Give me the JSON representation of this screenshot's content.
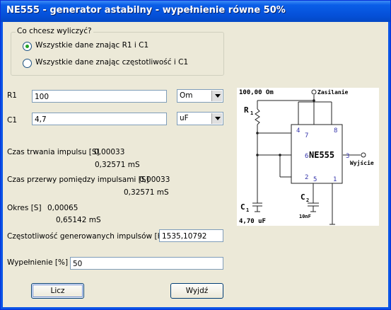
{
  "window": {
    "title": "NE555 - generator astabilny - wypełnienie równe 50%"
  },
  "mode": {
    "legend": "Co chcesz wyliczyć?",
    "options": [
      {
        "label": "Wszystkie dane znając R1 i C1",
        "selected": true
      },
      {
        "label": "Wszystkie dane znając częstotliwość i C1",
        "selected": false
      }
    ]
  },
  "inputs": {
    "r1": {
      "label": "R1",
      "value": "100",
      "unit": "Om"
    },
    "c1": {
      "label": "C1",
      "value": "4,7",
      "unit": "uF"
    }
  },
  "results": {
    "pulse": {
      "label": "Czas trwania impulsu [S]",
      "value": "0,00033",
      "value_ms": "0,32571 mS"
    },
    "gap": {
      "label": "Czas przerwy pomiędzy impulsami [S]",
      "value": "0,00033",
      "value_ms": "0,32571 mS"
    },
    "period": {
      "label": "Okres [S]",
      "value": "0,00065",
      "value_ms": "0,65142 mS"
    },
    "frequency": {
      "label": "Częstotliwość generowanych impulsów [Hz]",
      "value": "1535,10792"
    },
    "duty": {
      "label": "Wypełnienie [%]",
      "value": "50"
    }
  },
  "buttons": {
    "calc": "Licz",
    "exit": "Wyjdź"
  },
  "schematic": {
    "r_value": "100,00 Om",
    "c_value": "4,70 uF",
    "supply": "Zasilanie",
    "output": "Wyjście",
    "chip": "NE555",
    "r_label": "R",
    "r_sub": "1",
    "c1_label": "C",
    "c1_sub": "1",
    "c2_label": "C",
    "c2_sub": "2",
    "c2_value": "10nF",
    "pins": [
      "4",
      "8",
      "7",
      "6",
      "3",
      "2",
      "5",
      "1"
    ]
  }
}
